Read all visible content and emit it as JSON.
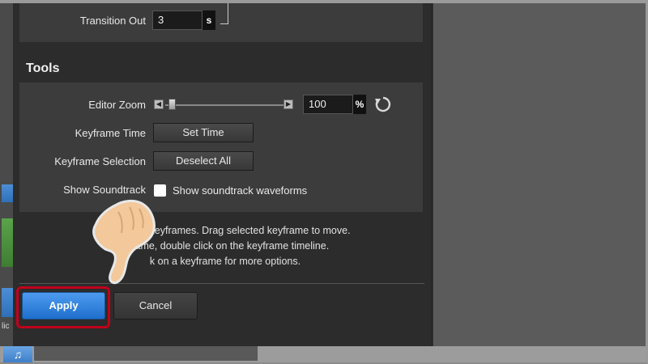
{
  "transition": {
    "label": "Transition Out",
    "value": "3",
    "unit": "s"
  },
  "tools": {
    "heading": "Tools",
    "editor_zoom": {
      "label": "Editor Zoom",
      "value": "100",
      "unit": "%",
      "slider_level": 0.03
    },
    "keyframe_time": {
      "label": "Keyframe Time",
      "button": "Set Time"
    },
    "keyframe_selection": {
      "label": "Keyframe Selection",
      "button": "Deselect All"
    },
    "show_soundtrack": {
      "label": "Show Soundtrack",
      "checkbox_label": "Show soundtrack waveforms",
      "checked": false
    }
  },
  "help": {
    "line1": "Click a      ect keyframes. Drag selected keyframe to move.",
    "line2": "To      ame, double click on the keyframe timeline.",
    "line3": "k on a keyframe for more options."
  },
  "footer": {
    "apply_label": "Apply",
    "cancel_label": "Cancel"
  },
  "left_strip": {
    "fragment": "lic"
  },
  "bottom_bar": {
    "music_icon": "♫"
  },
  "colors": {
    "apply_blue": "#2f80e0",
    "highlight_red": "#c0001b",
    "dialog_bg": "#2c2c2c",
    "section_bg": "#3c3c3c"
  }
}
